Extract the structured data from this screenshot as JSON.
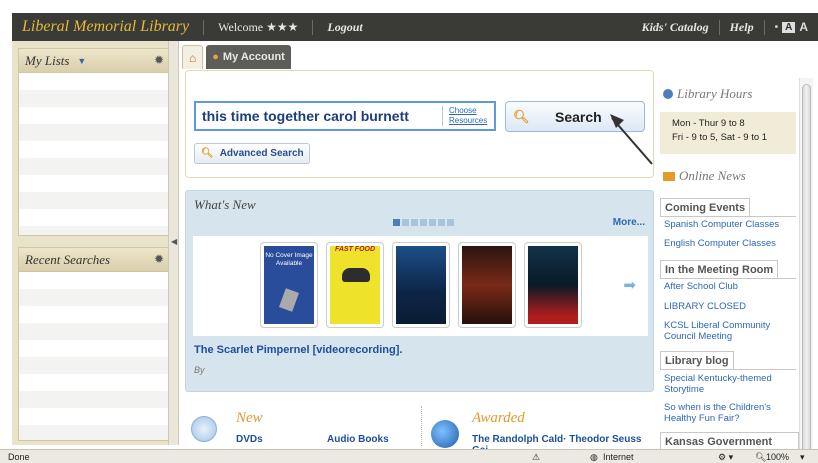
{
  "header": {
    "brand": "Liberal Memorial Library",
    "welcome": "Welcome ★★★",
    "logout": "Logout",
    "kids_catalog": "Kids' Catalog",
    "help": "Help",
    "font_small": "A",
    "font_large": "A"
  },
  "left": {
    "my_lists": "My Lists",
    "recent_searches": "Recent Searches"
  },
  "tabs": {
    "my_account": "My Account"
  },
  "search": {
    "query": "this time together carol burnett",
    "choose_resources_1": "Choose",
    "choose_resources_2": "Resources",
    "button": "Search",
    "advanced": "Advanced Search"
  },
  "whats_new": {
    "heading": "What's New",
    "more": "More...",
    "no_cover": "No Cover Image Available",
    "fast_food": "FAST FOOD",
    "item_title": "The Scarlet Pimpernel  [videorecording].",
    "by": "By"
  },
  "bottom": {
    "new_label": "New",
    "dvds": "DVDs",
    "audio_books": "Audio Books",
    "awarded_label": "Awarded",
    "awarded_link": "The Randolph Cald· Theodor Seuss Gei"
  },
  "right": {
    "library_hours": "Library Hours",
    "hours_line1": "Mon - Thur 9 to 8",
    "hours_line2": "Fri - 9 to 5, Sat - 9 to 1",
    "online_news": "Online News",
    "coming_events": "Coming Events",
    "event1": "Spanish Computer Classes",
    "event2": "English Computer Classes",
    "meeting_room": "In the Meeting Room",
    "meet1": "After School Club",
    "meet2": "LIBRARY CLOSED",
    "meet3": "KCSL Liberal Community Council Meeting",
    "library_blog": "Library blog",
    "blog1": "Special Kentucky-themed Storytime",
    "blog2": "So when is the Children's Healthy Fun Fair?",
    "kansas_gov": "Kansas Government Info"
  },
  "status": {
    "done": "Done",
    "zone": "Internet",
    "zoom": "100%"
  }
}
